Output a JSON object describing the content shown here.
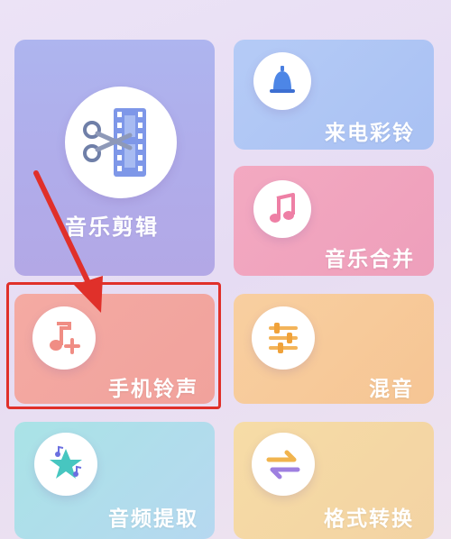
{
  "tools": {
    "music_edit": {
      "label": "音乐剪辑",
      "icon": "film-scissors-icon"
    },
    "ringtone_call": {
      "label": "来电彩铃",
      "icon": "bell-icon"
    },
    "music_merge": {
      "label": "音乐合并",
      "icon": "music-note-icon"
    },
    "phone_ringtone": {
      "label": "手机铃声",
      "icon": "music-note-plus-icon"
    },
    "mix": {
      "label": "混音",
      "icon": "equalizer-icon"
    },
    "audio_extract": {
      "label": "音频提取",
      "icon": "star-music-icon"
    },
    "format_convert": {
      "label": "格式转换",
      "icon": "swap-arrows-icon"
    }
  },
  "annotation": {
    "highlight_color": "#e0302a"
  },
  "colors": {
    "music_edit": "#b0acea",
    "ringtone_call": "#aec6f5",
    "music_merge": "#f0a4be",
    "phone_ringtone": "#f2a69f",
    "mix": "#f7ca9a",
    "audio_extract": "#afdeeb",
    "format_convert": "#f5d8a5"
  }
}
